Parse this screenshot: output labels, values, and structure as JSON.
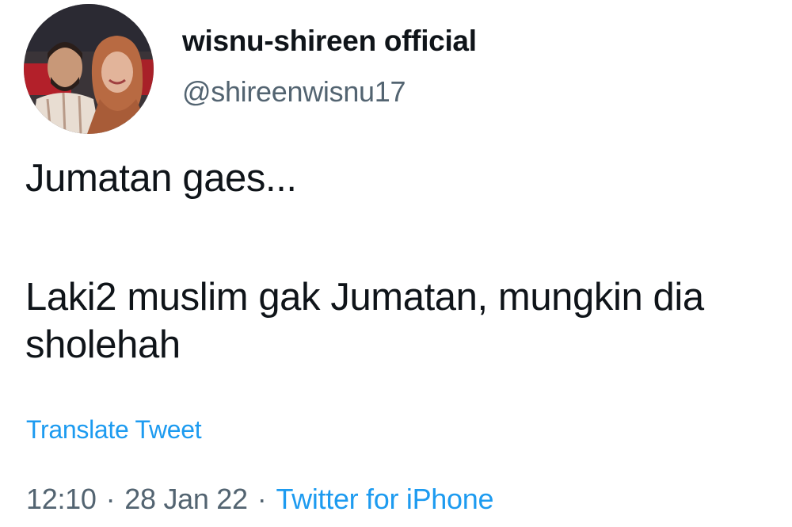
{
  "author": {
    "display_name": "wisnu-shireen official",
    "handle": "@shireenwisnu17",
    "avatar_icon": "profile-photo"
  },
  "tweet": {
    "line1": "Jumatan gaes...",
    "line2": "Laki2 muslim gak Jumatan, mungkin dia sholehah"
  },
  "actions": {
    "translate_label": "Translate Tweet"
  },
  "meta": {
    "time": "12:10",
    "separator": "·",
    "date": "28 Jan 22",
    "source": "Twitter for iPhone"
  },
  "colors": {
    "text": "#0f1419",
    "secondary": "#536471",
    "link": "#1d9bf0"
  }
}
